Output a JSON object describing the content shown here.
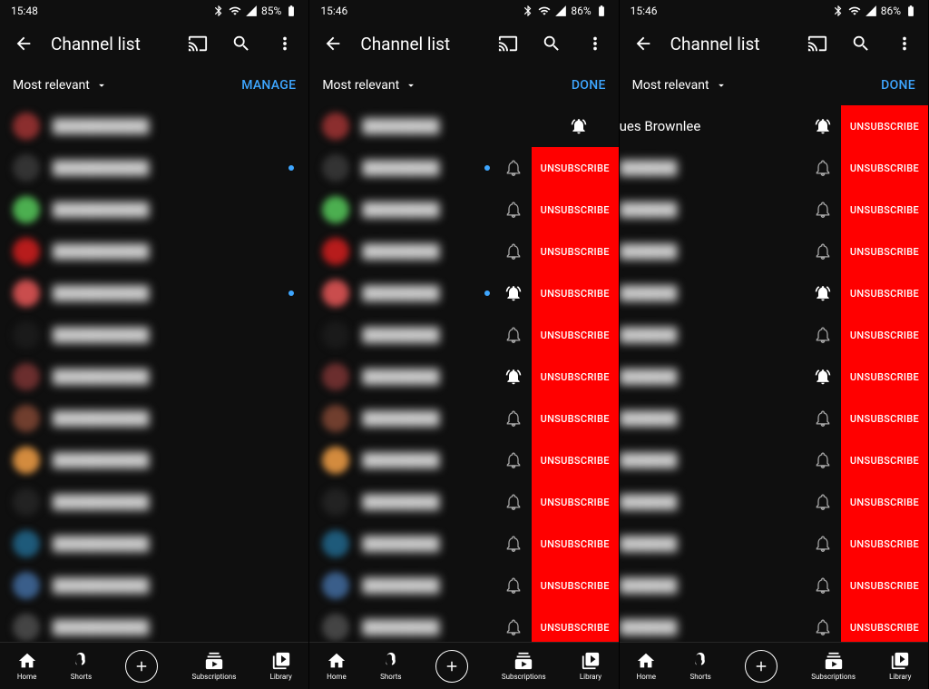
{
  "status": {
    "time_left": "15:48",
    "time_mid": "15:46",
    "time_right": "15:46",
    "battery_left": "85%",
    "battery_mid": "86%",
    "battery_right": "86%"
  },
  "appbar": {
    "title": "Channel list"
  },
  "sort": {
    "label": "Most relevant"
  },
  "actions": {
    "manage": "MANAGE",
    "done": "DONE"
  },
  "unsubscribe_label": "UNSUBSCRIBE",
  "nav": {
    "home": "Home",
    "shorts": "Shorts",
    "subs": "Subscriptions",
    "library": "Library"
  },
  "left": {
    "rows": [
      {
        "avatar": "#8b2e2e",
        "dot": false
      },
      {
        "avatar": "#333",
        "dot": true
      },
      {
        "avatar": "#4caf50",
        "dot": false
      },
      {
        "avatar": "#b71c1c",
        "dot": false
      },
      {
        "avatar": "#c94d4d",
        "dot": true
      },
      {
        "avatar": "#1a1a1a",
        "dot": false
      },
      {
        "avatar": "#6b2e2e",
        "dot": false
      },
      {
        "avatar": "#703e2e",
        "dot": false
      },
      {
        "avatar": "#d38b3e",
        "dot": false
      },
      {
        "avatar": "#222",
        "dot": false
      },
      {
        "avatar": "#1e5a7a",
        "dot": false
      },
      {
        "avatar": "#3a5e8a",
        "dot": false
      },
      {
        "avatar": "#444",
        "dot": false
      }
    ]
  },
  "mid": {
    "rows": [
      {
        "avatar": "#8b2e2e",
        "bell": "active",
        "dot": false,
        "unsub": false
      },
      {
        "avatar": "#333",
        "bell": "normal",
        "dot": true,
        "unsub": true
      },
      {
        "avatar": "#4caf50",
        "bell": "normal",
        "dot": false,
        "unsub": true
      },
      {
        "avatar": "#b71c1c",
        "bell": "normal",
        "dot": false,
        "unsub": true
      },
      {
        "avatar": "#c94d4d",
        "bell": "active",
        "dot": true,
        "unsub": true
      },
      {
        "avatar": "#1a1a1a",
        "bell": "normal",
        "dot": false,
        "unsub": true
      },
      {
        "avatar": "#6b2e2e",
        "bell": "active",
        "dot": false,
        "unsub": true
      },
      {
        "avatar": "#703e2e",
        "bell": "normal",
        "dot": false,
        "unsub": true
      },
      {
        "avatar": "#d38b3e",
        "bell": "normal",
        "dot": false,
        "unsub": true
      },
      {
        "avatar": "#222",
        "bell": "normal",
        "dot": false,
        "unsub": true
      },
      {
        "avatar": "#1e5a7a",
        "bell": "normal",
        "dot": false,
        "unsub": true
      },
      {
        "avatar": "#3a5e8a",
        "bell": "normal",
        "dot": false,
        "unsub": true
      },
      {
        "avatar": "#444",
        "bell": "normal",
        "dot": false,
        "unsub": true
      }
    ]
  },
  "right": {
    "visible_name": "ues Brownlee",
    "rows": [
      {
        "bell": "active",
        "unsub": true
      },
      {
        "bell": "normal",
        "unsub": true
      },
      {
        "bell": "normal",
        "unsub": true
      },
      {
        "bell": "normal",
        "unsub": true
      },
      {
        "bell": "active",
        "unsub": true
      },
      {
        "bell": "normal",
        "unsub": true
      },
      {
        "bell": "active",
        "unsub": true
      },
      {
        "bell": "normal",
        "unsub": true
      },
      {
        "bell": "normal",
        "unsub": true
      },
      {
        "bell": "normal",
        "unsub": true
      },
      {
        "bell": "normal",
        "unsub": true
      },
      {
        "bell": "normal",
        "unsub": true
      },
      {
        "bell": "normal",
        "unsub": true
      }
    ]
  }
}
